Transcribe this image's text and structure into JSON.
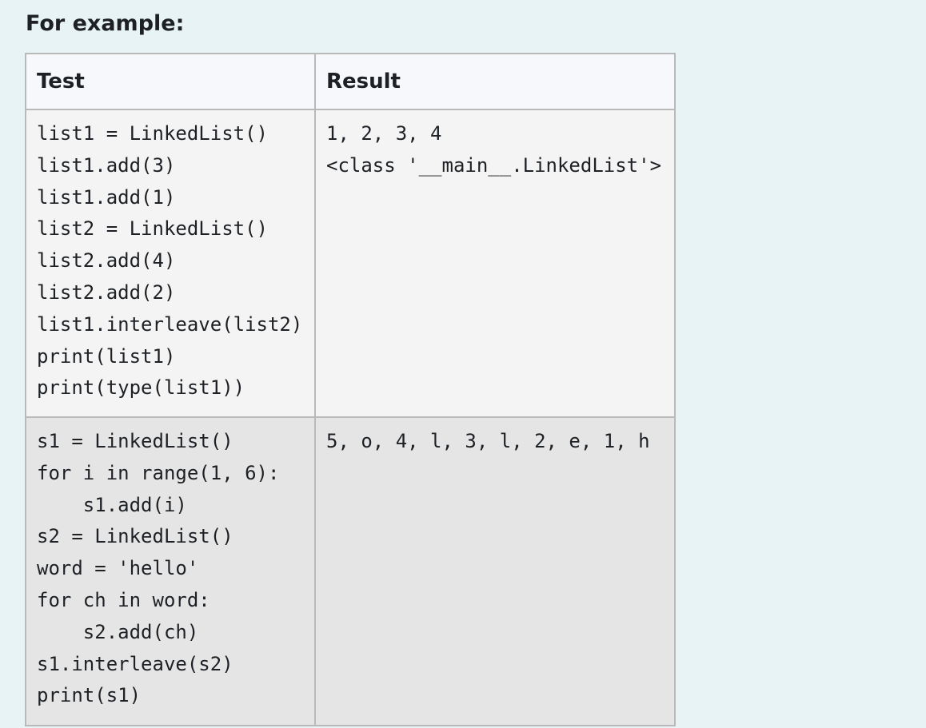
{
  "heading": "For example:",
  "table": {
    "headers": {
      "test": "Test",
      "result": "Result"
    },
    "rows": [
      {
        "test": "list1 = LinkedList()\nlist1.add(3)\nlist1.add(1)\nlist2 = LinkedList()\nlist2.add(4)\nlist2.add(2)\nlist1.interleave(list2)\nprint(list1)\nprint(type(list1))",
        "result": "1, 2, 3, 4\n<class '__main__.LinkedList'>"
      },
      {
        "test": "s1 = LinkedList()\nfor i in range(1, 6):\n    s1.add(i)\ns2 = LinkedList()\nword = 'hello'\nfor ch in word:\n    s2.add(ch)\ns1.interleave(s2)\nprint(s1)",
        "result": "5, o, 4, l, 3, l, 2, e, 1, h"
      }
    ]
  }
}
